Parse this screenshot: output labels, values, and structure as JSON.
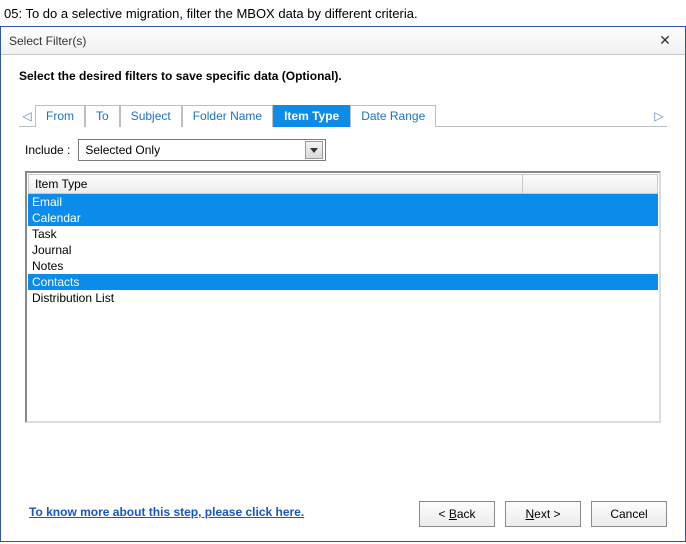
{
  "step": {
    "label": "05:  To do a selective migration, filter the MBOX data by different criteria."
  },
  "dialog": {
    "title": "Select Filter(s)",
    "instruction": "Select the desired filters to save specific data (Optional).",
    "tabs": [
      {
        "label": "From",
        "active": false
      },
      {
        "label": "To",
        "active": false
      },
      {
        "label": "Subject",
        "active": false
      },
      {
        "label": "Folder Name",
        "active": false
      },
      {
        "label": "Item Type",
        "active": true
      },
      {
        "label": "Date Range",
        "active": false
      }
    ],
    "include": {
      "label": "Include :",
      "value": "Selected Only"
    },
    "list": {
      "header": "Item Type",
      "items": [
        {
          "label": "Email",
          "selected": true
        },
        {
          "label": "Calendar",
          "selected": true
        },
        {
          "label": "Task",
          "selected": false
        },
        {
          "label": "Journal",
          "selected": false
        },
        {
          "label": "Notes",
          "selected": false
        },
        {
          "label": "Contacts",
          "selected": true
        },
        {
          "label": "Distribution List",
          "selected": false
        }
      ]
    },
    "help_link": "To know more about this step, please click here.",
    "buttons": {
      "back": {
        "prefix": "< ",
        "mnemonic": "B",
        "rest": "ack"
      },
      "next": {
        "mnemonic": "N",
        "rest": "ext >"
      },
      "cancel": {
        "label": "Cancel"
      }
    }
  }
}
